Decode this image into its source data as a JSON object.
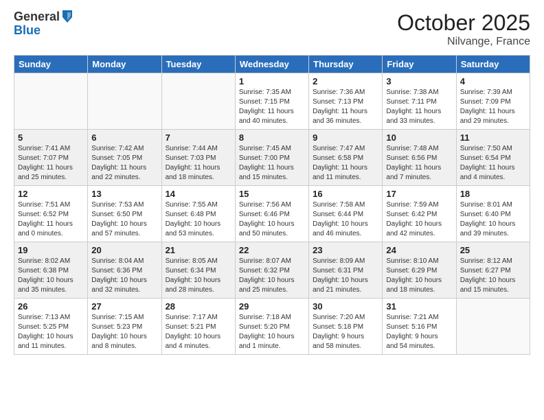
{
  "header": {
    "logo_general": "General",
    "logo_blue": "Blue",
    "month": "October 2025",
    "location": "Nilvange, France"
  },
  "weekdays": [
    "Sunday",
    "Monday",
    "Tuesday",
    "Wednesday",
    "Thursday",
    "Friday",
    "Saturday"
  ],
  "rows": [
    [
      {
        "day": "",
        "info": ""
      },
      {
        "day": "",
        "info": ""
      },
      {
        "day": "",
        "info": ""
      },
      {
        "day": "1",
        "info": "Sunrise: 7:35 AM\nSunset: 7:15 PM\nDaylight: 11 hours\nand 40 minutes."
      },
      {
        "day": "2",
        "info": "Sunrise: 7:36 AM\nSunset: 7:13 PM\nDaylight: 11 hours\nand 36 minutes."
      },
      {
        "day": "3",
        "info": "Sunrise: 7:38 AM\nSunset: 7:11 PM\nDaylight: 11 hours\nand 33 minutes."
      },
      {
        "day": "4",
        "info": "Sunrise: 7:39 AM\nSunset: 7:09 PM\nDaylight: 11 hours\nand 29 minutes."
      }
    ],
    [
      {
        "day": "5",
        "info": "Sunrise: 7:41 AM\nSunset: 7:07 PM\nDaylight: 11 hours\nand 25 minutes."
      },
      {
        "day": "6",
        "info": "Sunrise: 7:42 AM\nSunset: 7:05 PM\nDaylight: 11 hours\nand 22 minutes."
      },
      {
        "day": "7",
        "info": "Sunrise: 7:44 AM\nSunset: 7:03 PM\nDaylight: 11 hours\nand 18 minutes."
      },
      {
        "day": "8",
        "info": "Sunrise: 7:45 AM\nSunset: 7:00 PM\nDaylight: 11 hours\nand 15 minutes."
      },
      {
        "day": "9",
        "info": "Sunrise: 7:47 AM\nSunset: 6:58 PM\nDaylight: 11 hours\nand 11 minutes."
      },
      {
        "day": "10",
        "info": "Sunrise: 7:48 AM\nSunset: 6:56 PM\nDaylight: 11 hours\nand 7 minutes."
      },
      {
        "day": "11",
        "info": "Sunrise: 7:50 AM\nSunset: 6:54 PM\nDaylight: 11 hours\nand 4 minutes."
      }
    ],
    [
      {
        "day": "12",
        "info": "Sunrise: 7:51 AM\nSunset: 6:52 PM\nDaylight: 11 hours\nand 0 minutes."
      },
      {
        "day": "13",
        "info": "Sunrise: 7:53 AM\nSunset: 6:50 PM\nDaylight: 10 hours\nand 57 minutes."
      },
      {
        "day": "14",
        "info": "Sunrise: 7:55 AM\nSunset: 6:48 PM\nDaylight: 10 hours\nand 53 minutes."
      },
      {
        "day": "15",
        "info": "Sunrise: 7:56 AM\nSunset: 6:46 PM\nDaylight: 10 hours\nand 50 minutes."
      },
      {
        "day": "16",
        "info": "Sunrise: 7:58 AM\nSunset: 6:44 PM\nDaylight: 10 hours\nand 46 minutes."
      },
      {
        "day": "17",
        "info": "Sunrise: 7:59 AM\nSunset: 6:42 PM\nDaylight: 10 hours\nand 42 minutes."
      },
      {
        "day": "18",
        "info": "Sunrise: 8:01 AM\nSunset: 6:40 PM\nDaylight: 10 hours\nand 39 minutes."
      }
    ],
    [
      {
        "day": "19",
        "info": "Sunrise: 8:02 AM\nSunset: 6:38 PM\nDaylight: 10 hours\nand 35 minutes."
      },
      {
        "day": "20",
        "info": "Sunrise: 8:04 AM\nSunset: 6:36 PM\nDaylight: 10 hours\nand 32 minutes."
      },
      {
        "day": "21",
        "info": "Sunrise: 8:05 AM\nSunset: 6:34 PM\nDaylight: 10 hours\nand 28 minutes."
      },
      {
        "day": "22",
        "info": "Sunrise: 8:07 AM\nSunset: 6:32 PM\nDaylight: 10 hours\nand 25 minutes."
      },
      {
        "day": "23",
        "info": "Sunrise: 8:09 AM\nSunset: 6:31 PM\nDaylight: 10 hours\nand 21 minutes."
      },
      {
        "day": "24",
        "info": "Sunrise: 8:10 AM\nSunset: 6:29 PM\nDaylight: 10 hours\nand 18 minutes."
      },
      {
        "day": "25",
        "info": "Sunrise: 8:12 AM\nSunset: 6:27 PM\nDaylight: 10 hours\nand 15 minutes."
      }
    ],
    [
      {
        "day": "26",
        "info": "Sunrise: 7:13 AM\nSunset: 5:25 PM\nDaylight: 10 hours\nand 11 minutes."
      },
      {
        "day": "27",
        "info": "Sunrise: 7:15 AM\nSunset: 5:23 PM\nDaylight: 10 hours\nand 8 minutes."
      },
      {
        "day": "28",
        "info": "Sunrise: 7:17 AM\nSunset: 5:21 PM\nDaylight: 10 hours\nand 4 minutes."
      },
      {
        "day": "29",
        "info": "Sunrise: 7:18 AM\nSunset: 5:20 PM\nDaylight: 10 hours\nand 1 minute."
      },
      {
        "day": "30",
        "info": "Sunrise: 7:20 AM\nSunset: 5:18 PM\nDaylight: 9 hours\nand 58 minutes."
      },
      {
        "day": "31",
        "info": "Sunrise: 7:21 AM\nSunset: 5:16 PM\nDaylight: 9 hours\nand 54 minutes."
      },
      {
        "day": "",
        "info": ""
      }
    ]
  ]
}
